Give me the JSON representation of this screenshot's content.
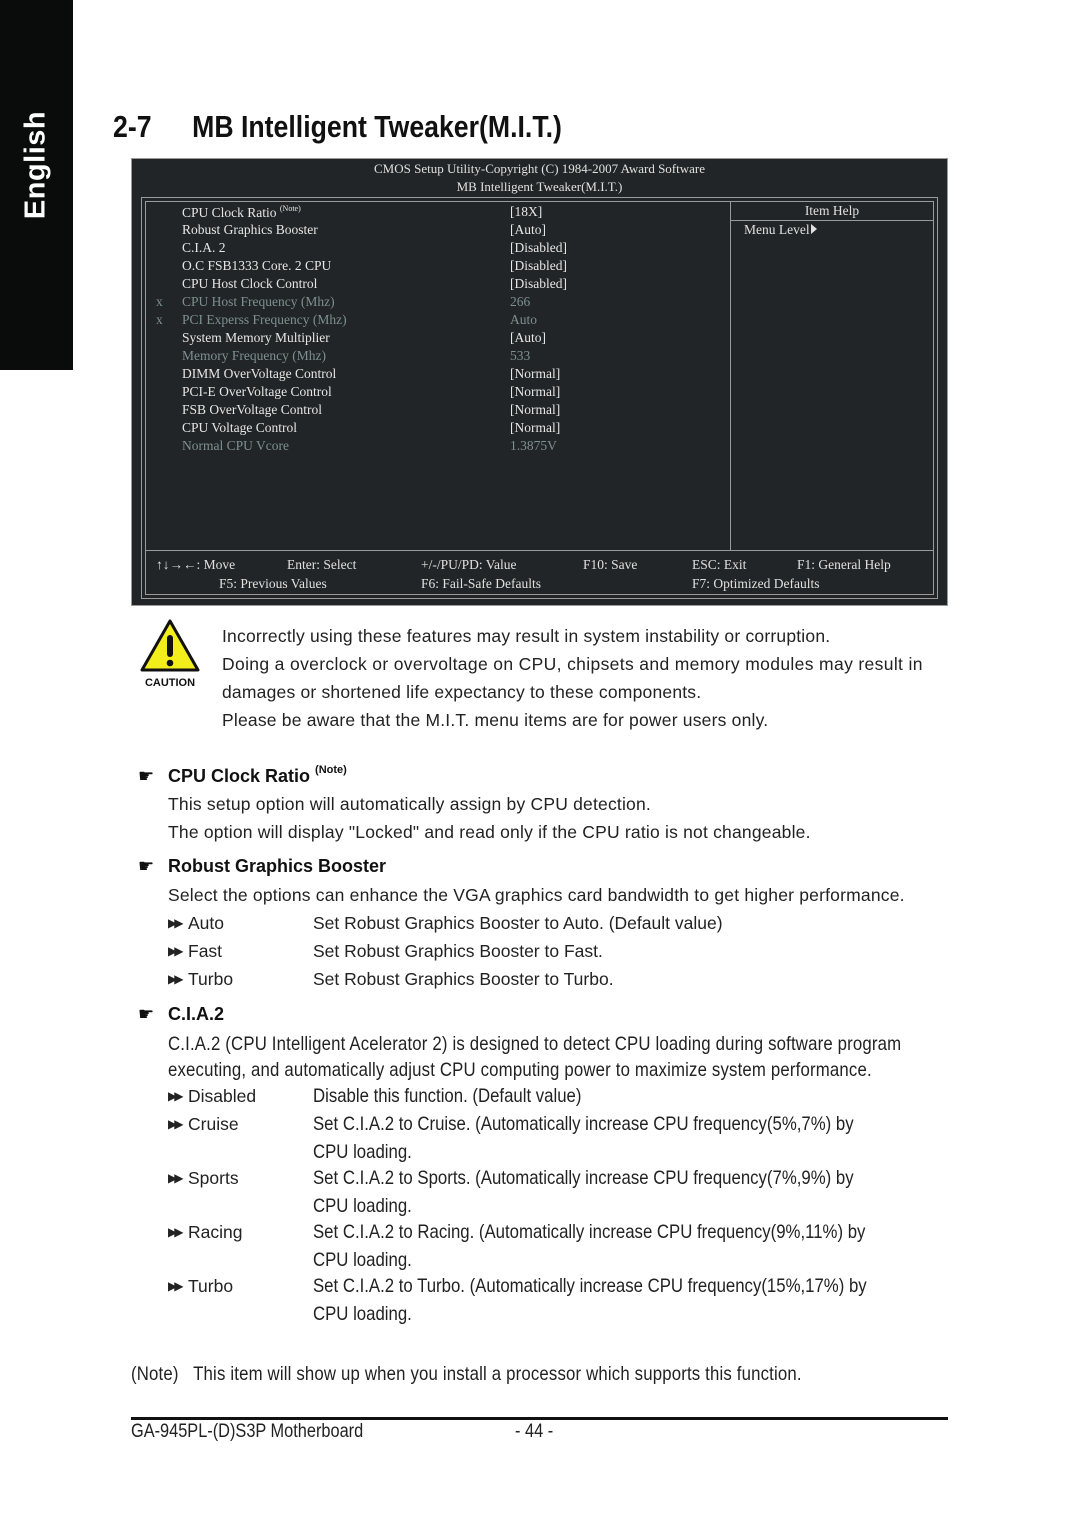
{
  "side_tab": {
    "label": "English"
  },
  "section": {
    "number": "2-7",
    "title": "MB Intelligent Tweaker(M.I.T.)"
  },
  "bios": {
    "header_line1": "CMOS Setup Utility-Copyright (C) 1984-2007 Award Software",
    "header_line2": "MB Intelligent Tweaker(M.I.T.)",
    "items": [
      {
        "mark": "",
        "name": "CPU Clock Ratio",
        "note": "(Note)",
        "value": "[18X]",
        "state": "active"
      },
      {
        "mark": "",
        "name": "Robust Graphics Booster",
        "note": "",
        "value": "[Auto]",
        "state": "active"
      },
      {
        "mark": "",
        "name": "C.I.A. 2",
        "note": "",
        "value": "[Disabled]",
        "state": "active"
      },
      {
        "mark": "",
        "name": "O.C FSB1333 Core. 2 CPU",
        "note": "",
        "value": "[Disabled]",
        "state": "active"
      },
      {
        "mark": "",
        "name": "CPU Host Clock Control",
        "note": "",
        "value": "[Disabled]",
        "state": "active"
      },
      {
        "mark": "x",
        "name": "CPU Host Frequency (Mhz)",
        "note": "",
        "value": "266",
        "state": "dim"
      },
      {
        "mark": "x",
        "name": "PCI Experss Frequency (Mhz)",
        "note": "",
        "value": "Auto",
        "state": "dim"
      },
      {
        "mark": "",
        "name": "System Memory Multiplier",
        "note": "",
        "value": "[Auto]",
        "state": "active"
      },
      {
        "mark": "",
        "name": "Memory Frequency (Mhz)",
        "note": "",
        "value": "533",
        "state": "dim"
      },
      {
        "mark": "",
        "name": "DIMM OverVoltage Control",
        "note": "",
        "value": "[Normal]",
        "state": "active"
      },
      {
        "mark": "",
        "name": "PCI-E OverVoltage Control",
        "note": "",
        "value": "[Normal]",
        "state": "active"
      },
      {
        "mark": "",
        "name": "FSB OverVoltage Control",
        "note": "",
        "value": "[Normal]",
        "state": "active"
      },
      {
        "mark": "",
        "name": "CPU Voltage Control",
        "note": "",
        "value": "[Normal]",
        "state": "active"
      },
      {
        "mark": "",
        "name": "Normal CPU Vcore",
        "note": "",
        "value": "1.3875V",
        "state": "dim"
      }
    ],
    "help": {
      "title": "Item Help",
      "menu_level": "Menu Level"
    },
    "keys": {
      "move": "↑↓→←: Move",
      "enter": "Enter: Select",
      "value": "+/-/PU/PD: Value",
      "save": "F10: Save",
      "exit": "ESC: Exit",
      "help": "F1: General Help",
      "prev": "F5: Previous Values",
      "failsafe": "F6: Fail-Safe Defaults",
      "optimized": "F7: Optimized Defaults"
    }
  },
  "caution": {
    "icon_label": "CAUTION",
    "lines": [
      "Incorrectly using these features may result in system instability or corruption.",
      "Doing a overclock or overvoltage on CPU, chipsets and memory modules may result in",
      "damages or shortened life expectancy to these components.",
      "Please be aware that the M.I.T. menu items are for power users only."
    ]
  },
  "cpu_clock_ratio": {
    "title": "CPU Clock Ratio",
    "note": "(Note)",
    "lines": [
      "This setup option will automatically assign by CPU detection.",
      "The option will display \"Locked\" and read only if the CPU ratio is not changeable."
    ]
  },
  "robust_graphics": {
    "title": "Robust Graphics Booster",
    "intro": "Select the options can enhance the VGA graphics card bandwidth to get higher performance.",
    "options": [
      {
        "name": "Auto",
        "desc": "Set Robust Graphics Booster to Auto. (Default value)"
      },
      {
        "name": "Fast",
        "desc": "Set Robust Graphics Booster to Fast."
      },
      {
        "name": "Turbo",
        "desc": "Set Robust Graphics Booster to Turbo."
      }
    ]
  },
  "cia2": {
    "title": "C.I.A.2",
    "intro1": "C.I.A.2 (CPU Intelligent Acelerator 2) is designed to detect CPU loading during software program",
    "intro2": "executing, and automatically adjust CPU computing power to maximize system performance.",
    "options": [
      {
        "name": "Disabled",
        "desc": "Disable this function. (Default value)",
        "desc2": ""
      },
      {
        "name": "Cruise",
        "desc": "Set C.I.A.2 to Cruise. (Automatically increase CPU frequency(5%,7%) by",
        "desc2": "CPU loading."
      },
      {
        "name": "Sports",
        "desc": "Set C.I.A.2 to Sports. (Automatically increase CPU frequency(7%,9%) by",
        "desc2": "CPU loading."
      },
      {
        "name": "Racing",
        "desc": "Set C.I.A.2 to Racing. (Automatically increase CPU frequency(9%,11%) by",
        "desc2": "CPU loading."
      },
      {
        "name": "Turbo",
        "desc": "Set C.I.A.2 to Turbo. (Automatically increase CPU frequency(15%,17%) by",
        "desc2": "CPU loading."
      }
    ]
  },
  "note": {
    "label": "(Note)",
    "text": "This item will show up when you install a processor which supports this function."
  },
  "footer": {
    "model": "GA-945PL-(D)S3P Motherboard",
    "page": "- 44 -"
  },
  "colors": {
    "bios_bg": "#222527",
    "bios_text": "#e0e0e0",
    "bios_dim": "#7e9090",
    "caution_yellow": "#f2ee1c"
  }
}
